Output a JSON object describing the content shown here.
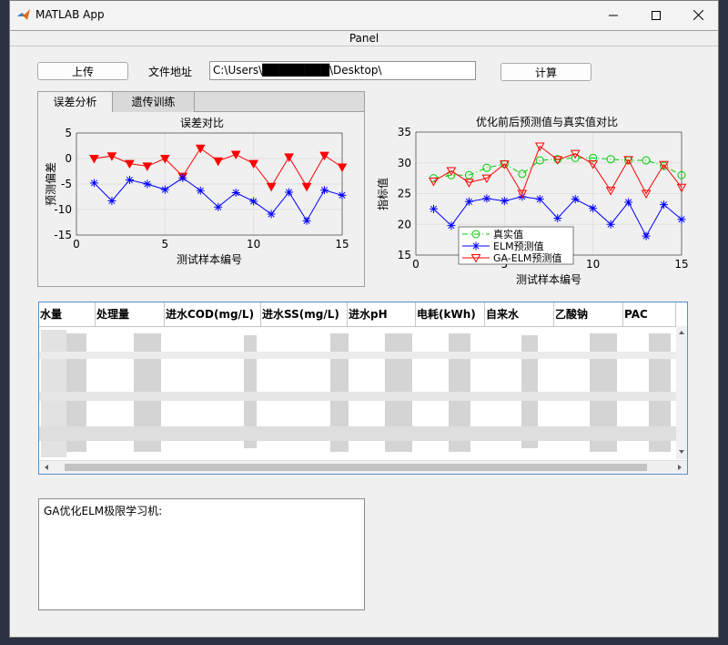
{
  "window": {
    "title": "MATLAB App",
    "panel_title": "Panel"
  },
  "toolbar": {
    "upload_label": "上传",
    "file_path_label": "文件地址",
    "file_path_value": "C:\\Users\\████████\\Desktop\\",
    "compute_label": "计算"
  },
  "tabs": [
    {
      "label": "误差分析",
      "selected": true
    },
    {
      "label": "遗传训练",
      "selected": false
    }
  ],
  "chart_data": [
    {
      "type": "line",
      "title": "误差对比",
      "xlabel": "测试样本编号",
      "ylabel": "预测偏差",
      "xlim": [
        0,
        15
      ],
      "ylim": [
        -15,
        5
      ],
      "xticks": [
        "0",
        "5",
        "10",
        "15"
      ],
      "yticks": [
        "5",
        "0",
        "-5",
        "-10",
        "-15"
      ],
      "grid": true,
      "x": [
        1,
        2,
        3,
        4,
        5,
        6,
        7,
        8,
        9,
        10,
        11,
        12,
        13,
        14,
        15
      ],
      "series": [
        {
          "color": "#ff0000",
          "marker": "triangle-down-filled",
          "values": [
            0,
            0.5,
            -1,
            -1.5,
            0,
            -3.5,
            2,
            -0.5,
            0.8,
            -1,
            -5.5,
            0.3,
            -5.5,
            0.6,
            -1.7
          ]
        },
        {
          "color": "#0000ff",
          "marker": "star",
          "values": [
            -4.8,
            -8.3,
            -4.2,
            -5,
            -6.1,
            -3.8,
            -6.3,
            -9.5,
            -6.7,
            -8.4,
            -10.9,
            -6.6,
            -12.2,
            -6.2,
            -7.2
          ]
        }
      ]
    },
    {
      "type": "line",
      "title": "优化前后预测值与真实值对比",
      "xlabel": "测试样本编号",
      "ylabel": "指标值",
      "xlim": [
        0,
        15
      ],
      "ylim": [
        15,
        35
      ],
      "xticks": [
        "0",
        "5",
        "10",
        "15"
      ],
      "yticks": [
        "35",
        "30",
        "25",
        "20",
        "15"
      ],
      "grid": true,
      "legend_position": "bottom-center",
      "x": [
        1,
        2,
        3,
        4,
        5,
        6,
        7,
        8,
        9,
        10,
        11,
        12,
        13,
        14,
        15
      ],
      "series": [
        {
          "name": "真实值",
          "color": "#00cc00",
          "marker": "circle",
          "dash": "6,3,1,3",
          "values": [
            27.5,
            28,
            28,
            29.2,
            29.8,
            28.2,
            30.4,
            30.6,
            30.8,
            30.8,
            30.6,
            30.4,
            30.4,
            29.5,
            28
          ]
        },
        {
          "name": "ELM预测值",
          "color": "#0000ff",
          "marker": "star",
          "values": [
            22.5,
            19.8,
            23.7,
            24.2,
            23.8,
            24.5,
            24.1,
            21,
            24.1,
            22.6,
            20,
            23.6,
            18.1,
            23.2,
            20.8
          ]
        },
        {
          "name": "GA-ELM预测值",
          "color": "#ff0000",
          "marker": "triangle-down",
          "values": [
            27,
            28.7,
            26.8,
            27.5,
            29.8,
            25,
            32.7,
            30.5,
            31.5,
            29.8,
            25.5,
            30.5,
            25,
            29.7,
            26
          ]
        }
      ]
    }
  ],
  "table": {
    "columns": [
      "水量",
      "处理量",
      "进水COD(mg/L)",
      "进水SS(mg/L)",
      "进水pH",
      "电耗(kWh)",
      "自来水",
      "乙酸钠",
      "PAC"
    ]
  },
  "result": {
    "text": "GA优化ELM极限学习机:"
  }
}
